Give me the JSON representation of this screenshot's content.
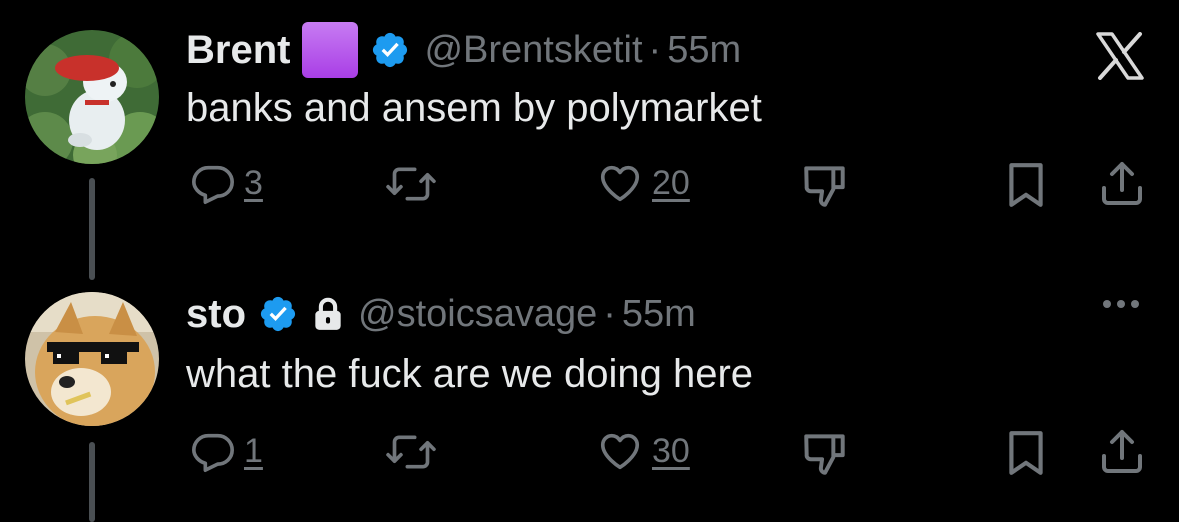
{
  "app": {
    "brand_icon": "x-logo-icon"
  },
  "tweets": [
    {
      "name": "Brent",
      "name_badge": "purple-square-emoji",
      "verified_icon": "verified-badge-icon",
      "handle": "@Brentsketit",
      "separator": "·",
      "time": "55m",
      "text": "banks and ansem by polymarket",
      "avatar": "avatar-white-dog-red-beret",
      "actions": {
        "reply_count": "3",
        "repost_count": "",
        "like_count": "20"
      },
      "top_right_icon": "x-logo-icon"
    },
    {
      "name": "sto",
      "verified_icon": "verified-badge-icon",
      "protected_icon": "lock-icon",
      "handle": "@stoicsavage",
      "separator": "·",
      "time": "55m",
      "text": "what the fuck are we doing here",
      "avatar": "avatar-doge-sunglasses",
      "actions": {
        "reply_count": "1",
        "repost_count": "",
        "like_count": "30"
      },
      "top_right_icon": "more-icon"
    }
  ],
  "colors": {
    "background": "#000000",
    "text": "#e7e9ea",
    "secondary": "#71767b",
    "verified": "#1d9bf0",
    "emoji_purple": "#a93ee6"
  }
}
